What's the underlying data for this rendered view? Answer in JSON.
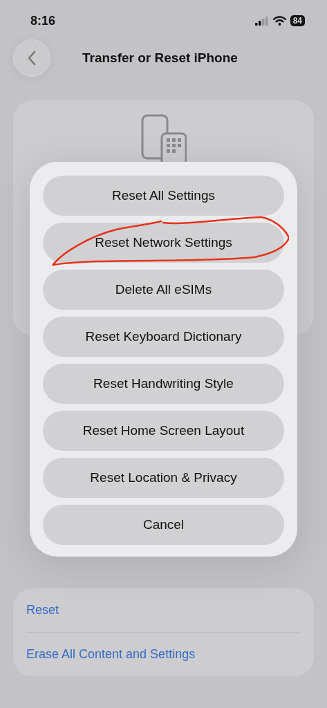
{
  "status_bar": {
    "time": "8:16",
    "battery": "84"
  },
  "header": {
    "title": "Transfer or Reset iPhone"
  },
  "action_sheet": {
    "options": [
      {
        "label": "Reset All Settings",
        "circled": false
      },
      {
        "label": "Reset Network Settings",
        "circled": true
      },
      {
        "label": "Delete All eSIMs",
        "circled": false
      },
      {
        "label": "Reset Keyboard Dictionary",
        "circled": false
      },
      {
        "label": "Reset Handwriting Style",
        "circled": false
      },
      {
        "label": "Reset Home Screen Layout",
        "circled": false
      },
      {
        "label": "Reset Location & Privacy",
        "circled": false
      },
      {
        "label": "Cancel",
        "circled": false
      }
    ]
  },
  "reset_list": {
    "items": [
      "Reset",
      "Erase All Content and Settings"
    ]
  }
}
